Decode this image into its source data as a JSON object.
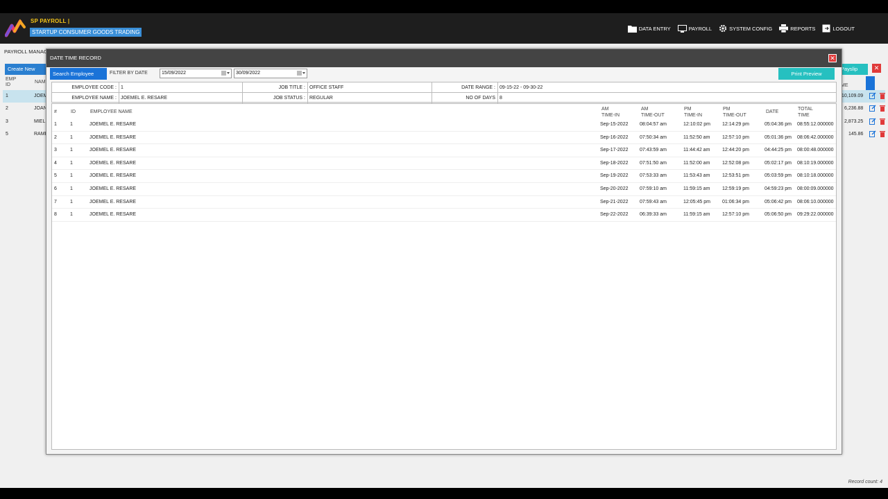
{
  "brand": {
    "title": "SP PAYROLL |",
    "company": "STARTUP CONSUMER GOODS TRADING"
  },
  "nav": [
    {
      "label": "DATA ENTRY",
      "icon": "folder-icon"
    },
    {
      "label": "PAYROLL",
      "icon": "monitor-icon"
    },
    {
      "label": "SYSTEM CONFIG",
      "icon": "gear-icon"
    },
    {
      "label": "REPORTS",
      "icon": "printer-icon"
    },
    {
      "label": "LOGOUT",
      "icon": "logout-icon"
    }
  ],
  "background": {
    "page_title": "PAYROLL MANAGE",
    "create_new": "Create New",
    "payslip": "Payslip",
    "col_emp_id": "EMP ID",
    "col_name": "NAM",
    "col_amount": "ME",
    "rows": [
      {
        "id": "1",
        "name": "JOEM",
        "amount": "10,109.09"
      },
      {
        "id": "2",
        "name": "JOAN",
        "amount": "6,236.88"
      },
      {
        "id": "3",
        "name": "MIEL",
        "amount": "2,873.25"
      },
      {
        "id": "5",
        "name": "RAME",
        "amount": "145.86"
      }
    ],
    "record_count": "Record count: 4"
  },
  "modal": {
    "title": "DATE TIME RECORD",
    "search_button": "Search Employee",
    "filter_label": "FILTER BY DATE",
    "date_from": "15/09/2022",
    "date_to": "30/09/2022",
    "print_button": "Print Preview",
    "info": {
      "employee_code_label": "EMPLOYEE CODE :",
      "employee_code": "1",
      "employee_name_label": "EMPLOYEE NAME :",
      "employee_name": "JOEMEL E. RESARE",
      "job_title_label": "JOB TITLE :",
      "job_title": "OFFICE STAFF",
      "job_status_label": "JOB STATUS :",
      "job_status": "REGULAR",
      "date_range_label": "DATE RANGE :",
      "date_range": "09-15-22 - 09-30-22",
      "no_of_days_label": "NO OF DAYS",
      "no_of_days": "8"
    },
    "headers": {
      "num": "#",
      "id": "ID",
      "name": "EMPLOYEE NAME",
      "am_in_1": "AM",
      "am_in_2": "TIME-IN",
      "am_out_1": "AM",
      "am_out_2": "TIME-OUT",
      "pm_in_1": "PM",
      "pm_in_2": "TIME-IN",
      "pm_out_1": "PM",
      "pm_out_2": "TIME-OUT",
      "date": "DATE",
      "total_1": "TOTAL",
      "total_2": "TIME"
    },
    "rows": [
      {
        "num": "1",
        "id": "1",
        "name": "JOEMEL E. RESARE",
        "am_in": "Sep-15-2022",
        "am_out": "08:04:57 am",
        "pm_in": "12:10:02 pm",
        "pm_out": "12:14:29 pm",
        "date": "05:04:36 pm",
        "total": "08:55:12.000000"
      },
      {
        "num": "2",
        "id": "1",
        "name": "JOEMEL E. RESARE",
        "am_in": "Sep-16-2022",
        "am_out": "07:50:34 am",
        "pm_in": "11:52:50 am",
        "pm_out": "12:57:10 pm",
        "date": "05:01:36 pm",
        "total": "08:06:42.000000"
      },
      {
        "num": "3",
        "id": "1",
        "name": "JOEMEL E. RESARE",
        "am_in": "Sep-17-2022",
        "am_out": "07:43:59 am",
        "pm_in": "11:44:42 am",
        "pm_out": "12:44:20 pm",
        "date": "04:44:25 pm",
        "total": "08:00:48.000000"
      },
      {
        "num": "4",
        "id": "1",
        "name": "JOEMEL E. RESARE",
        "am_in": "Sep-18-2022",
        "am_out": "07:51:50 am",
        "pm_in": "11:52:00 am",
        "pm_out": "12:52:08 pm",
        "date": "05:02:17 pm",
        "total": "08:10:19.000000"
      },
      {
        "num": "5",
        "id": "1",
        "name": "JOEMEL E. RESARE",
        "am_in": "Sep-19-2022",
        "am_out": "07:53:33 am",
        "pm_in": "11:53:43 am",
        "pm_out": "12:53:51 pm",
        "date": "05:03:59 pm",
        "total": "08:10:18.000000"
      },
      {
        "num": "6",
        "id": "1",
        "name": "JOEMEL E. RESARE",
        "am_in": "Sep-20-2022",
        "am_out": "07:59:10 am",
        "pm_in": "11:59:15 am",
        "pm_out": "12:59:19 pm",
        "date": "04:59:23 pm",
        "total": "08:00:09.000000"
      },
      {
        "num": "7",
        "id": "1",
        "name": "JOEMEL E. RESARE",
        "am_in": "Sep-21-2022",
        "am_out": "07:59:43 am",
        "pm_in": "12:05:45 pm",
        "pm_out": "01:06:34 pm",
        "date": "05:06:42 pm",
        "total": "08:06:10.000000"
      },
      {
        "num": "8",
        "id": "1",
        "name": "JOEMEL E. RESARE",
        "am_in": "Sep-22-2022",
        "am_out": "06:39:33 am",
        "pm_in": "11:59:15 am",
        "pm_out": "12:57:10 pm",
        "date": "05:06:50 pm",
        "total": "09:29:22.000000"
      }
    ]
  },
  "colors": {
    "accent_blue": "#1a73d8",
    "teal": "#26c0c0",
    "close_red": "#e03a3a",
    "brand_yellow": "#f5c518"
  }
}
